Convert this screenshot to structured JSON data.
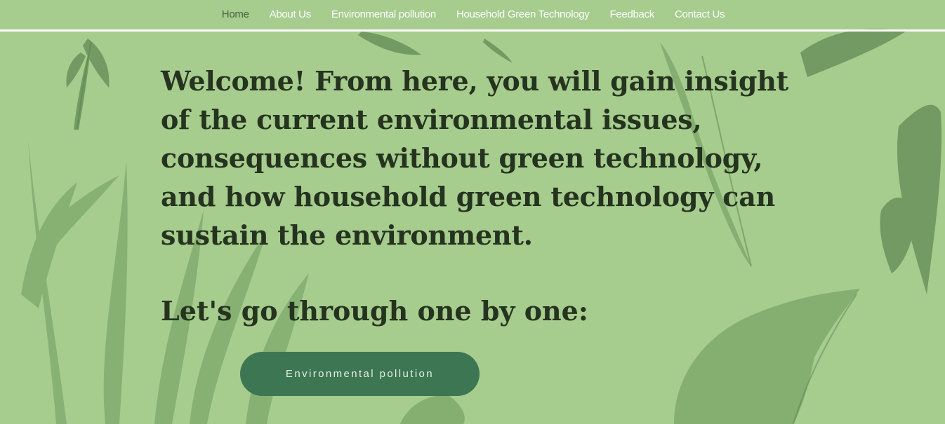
{
  "nav": {
    "items": [
      {
        "label": "Home",
        "active": true
      },
      {
        "label": "About Us",
        "active": false
      },
      {
        "label": "Environmental pollution",
        "active": false
      },
      {
        "label": "Household Green Technology",
        "active": false
      },
      {
        "label": "Feedback",
        "active": false
      },
      {
        "label": "Contact Us",
        "active": false
      }
    ]
  },
  "hero": {
    "intro": "Welcome! From here, you will gain insight of the current environmental issues, consequences without green technology, and how household green technology can sustain the environment.",
    "prompt": "Let's go through one by one:"
  },
  "cta": {
    "label": "Environmental pollution"
  },
  "colors": {
    "background": "#a6cc8e",
    "leaf": "#6f9a5e",
    "leaf_dark": "#58804c",
    "text": "#25331f",
    "button": "#3d7652",
    "button_text": "#e7f0e3",
    "nav_text": "#ffffff",
    "nav_active": "#4a6040"
  }
}
